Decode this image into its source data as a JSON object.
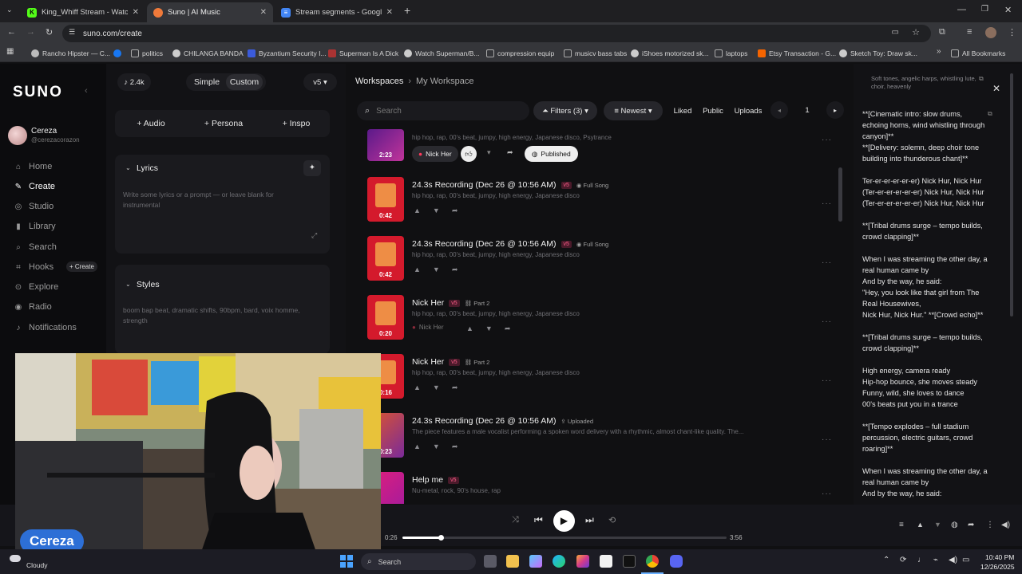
{
  "browser": {
    "tabs": [
      {
        "label": "King_Whiff Stream - Watch Live",
        "favicon_color": "#53fc18",
        "favicon_glyph": "K"
      },
      {
        "label": "Suno | AI Music",
        "favicon_color": "#f07a3a",
        "favicon_glyph": ""
      },
      {
        "label": "Stream segments - Google Docs",
        "favicon_color": "#4285f4",
        "favicon_glyph": "≡"
      }
    ],
    "new_tab": "+",
    "url": "suno.com/create",
    "bookmarks": [
      "Rancho Hipster — C...",
      "politics",
      "CHILANGA BANDA",
      "Byzantium Security I...",
      "Superman Is A Dick",
      "Watch Superman/B...",
      "compression equip",
      "musicv bass tabs",
      "iShoes motorized sk...",
      "laptops",
      "Etsy Transaction - G...",
      "Sketch Toy: Draw sk..."
    ],
    "all_bookmarks": "All Bookmarks"
  },
  "sidebar": {
    "logo": "SUNO",
    "user_name": "Cereza",
    "user_handle": "@cerezacorazon",
    "items": [
      {
        "label": "Home",
        "icon": "house-icon"
      },
      {
        "label": "Create",
        "icon": "create-icon"
      },
      {
        "label": "Studio",
        "icon": "studio-icon"
      },
      {
        "label": "Library",
        "icon": "library-icon"
      },
      {
        "label": "Search",
        "icon": "search-icon"
      },
      {
        "label": "Hooks",
        "icon": "hooks-icon"
      },
      {
        "label": "Explore",
        "icon": "explore-icon"
      },
      {
        "label": "Radio",
        "icon": "radio-icon"
      },
      {
        "label": "Notifications",
        "icon": "bell-icon"
      }
    ],
    "hooks_create": "+ Create"
  },
  "create": {
    "credits": "2.4k",
    "mode_simple": "Simple",
    "mode_custom": "Custom",
    "version": "v5",
    "add_audio": "+ Audio",
    "add_persona": "+ Persona",
    "add_inspo": "+ Inspo",
    "lyrics_label": "Lyrics",
    "lyrics_placeholder": "Write some lyrics or a prompt — or leave blank for instrumental",
    "styles_label": "Styles",
    "styles_value": "boom bap beat, dramatic shifts, 90bpm, bard, voix homme, strength"
  },
  "workspace": {
    "crumb_root": "Workspaces",
    "crumb_current": "My Workspace",
    "search_placeholder": "Search",
    "filters": "Filters (3)",
    "sort": "Newest",
    "liked": "Liked",
    "public": "Public",
    "uploads": "Uploads",
    "page": "1",
    "songs": [
      {
        "title": "",
        "genre": "hip hop, rap, 00's beat, jumpy, high energy, Japanese disco, Psytrance",
        "duration": "2:23",
        "artist": "Nick Her",
        "published": "Published",
        "color": "#7b1fa2"
      },
      {
        "title": "24.3s Recording (Dec 26 @ 10:56 AM)",
        "version": "v5",
        "tag": "Full Song",
        "genre": "hip hop, rap, 00's beat, jumpy, high energy, Japanese disco",
        "duration": "0:42",
        "color": "#d41a2c"
      },
      {
        "title": "24.3s Recording (Dec 26 @ 10:56 AM)",
        "version": "v5",
        "tag": "Full Song",
        "genre": "hip hop, rap, 00's beat, jumpy, high energy, Japanese disco",
        "duration": "0:42",
        "color": "#d41a2c"
      },
      {
        "title": "Nick Her",
        "version": "v5",
        "tag": "Part 2",
        "genre": "hip hop, rap, 00's beat, jumpy, high energy, Japanese disco",
        "duration": "0:20",
        "artist": "Nick Her",
        "color": "#d41a2c"
      },
      {
        "title": "Nick Her",
        "version": "v5",
        "tag": "Part 2",
        "genre": "hip hop, rap, 00's beat, jumpy, high energy, Japanese disco",
        "duration": "0:16",
        "color": "#d41a2c"
      },
      {
        "title": "24.3s Recording (Dec 26 @ 10:56 AM)",
        "tag": "Uploaded",
        "genre": "The piece features a male vocalist performing a spoken word delivery with a rhythmic, almost chant-like quality. The...",
        "duration": "0:23",
        "color": "#e0572a"
      },
      {
        "title": "Help me",
        "version": "v5",
        "genre": "Nu-metal, rock, 90's house, rap",
        "duration": "",
        "color": "#e0207a"
      }
    ]
  },
  "lyrics_panel": {
    "style_snippet": "Soft tones, angelic harps, whistling lute, choir, heavenly",
    "lines": [
      "**[Cinematic intro: slow drums,",
      "echoing horns, wind whistling through",
      "canyon]**",
      "**[Delivery: solemn, deep choir tone",
      "building into thunderous chant]**",
      "",
      "Ter-er-er-er-er-er) Nick Hur, Nick Hur",
      "(Ter-er-er-er-er-er) Nick Hur, Nick Hur",
      "(Ter-er-er-er-er-er) Nick Hur, Nick Hur",
      "",
      "**[Tribal drums surge – tempo builds,",
      "crowd clapping]**",
      "",
      "When I was streaming the other day, a",
      "real human came by",
      "And by the way, he said:",
      "\"Hey, you look like that girl from The",
      "Real Housewives,",
      "Nick Hur, Nick Hur.\" **[Crowd echo]**",
      "",
      "**[Tribal drums surge – tempo builds,",
      "crowd clapping]**",
      "",
      "High energy, camera ready",
      "Hip-hop bounce, she moves steady",
      "Funny, wild, she loves to dance",
      "00's beats put you in a trance",
      "",
      "**[Tempo explodes – full stadium",
      "percussion, electric guitars, crowd",
      "roaring]**",
      "",
      "When I was streaming the other day, a",
      "real human came by",
      "And by the way, he said:"
    ]
  },
  "player": {
    "elapsed": "0:26",
    "total": "3:56",
    "progress": 0.12
  },
  "stream_overlay": {
    "name": "Cereza"
  },
  "taskbar": {
    "weather": "Cloudy",
    "search": "Search",
    "time": "10:40 PM",
    "date": "12/26/2025"
  }
}
